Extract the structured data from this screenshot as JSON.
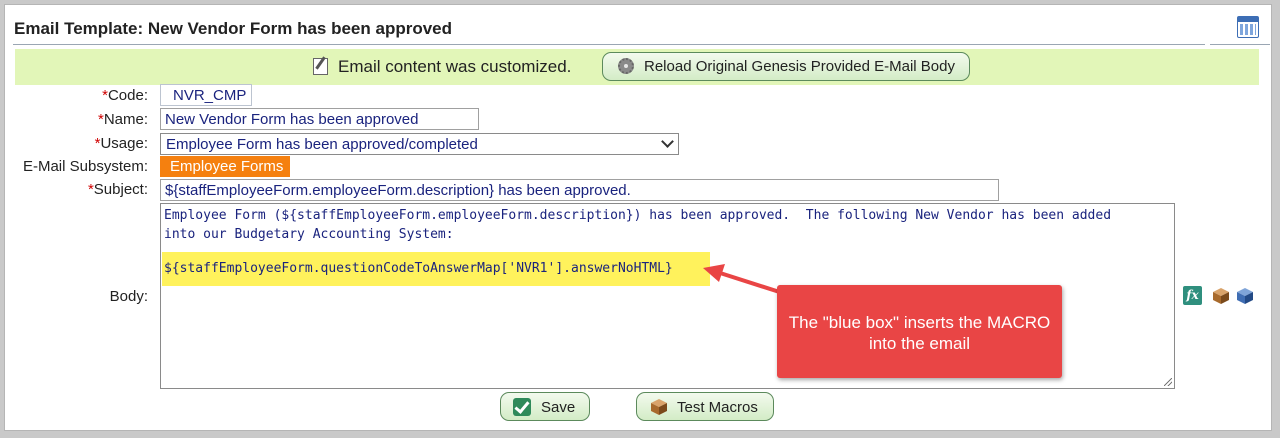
{
  "header": {
    "title": "Email Template: New Vendor Form has been approved",
    "calendar_icon": "calendar-icon"
  },
  "notice": {
    "text": "Email content was customized.",
    "icon": "edit-icon",
    "reload_label": "Reload Original Genesis Provided E-Mail Body",
    "reload_icon": "gear-icon"
  },
  "form": {
    "code_label": "Code:",
    "code_value": "NVR_CMP",
    "name_label": "Name:",
    "name_value": "New Vendor Form has been approved",
    "usage_label": "Usage:",
    "usage_value": "Employee Form has been approved/completed",
    "subsystem_label": "E-Mail Subsystem:",
    "subsystem_value": "Employee Forms",
    "subject_label": "Subject:",
    "subject_value": "${staffEmployeeForm.employeeForm.description} has been approved.",
    "body_label": "Body:",
    "required_mark": "*",
    "body_lines": [
      "Employee Form (${staffEmployeeForm.employeeForm.description}) has been approved.  The following New Vendor has been added",
      "into our Budgetary Accounting System:",
      "",
      "${staffEmployeeForm.questionCodeToAnswerMap['NVR1'].answerNoHTML}"
    ]
  },
  "side_icons": {
    "fx_label": "fx",
    "fx_icon": "function-fx-icon",
    "macro_icon": "brown-box-macro-icon",
    "insert_icon": "blue-box-insert-icon"
  },
  "callout": {
    "text": "The \"blue box\" inserts the MACRO into the email",
    "color": "#e94545"
  },
  "buttons": {
    "save_label": "Save",
    "test_macros_label": "Test Macros"
  },
  "colors": {
    "notice_bg": "#e2f6b8",
    "subsystem_badge": "#f5800f",
    "highlight": "#fff25c",
    "text_blue": "#1a237e"
  }
}
